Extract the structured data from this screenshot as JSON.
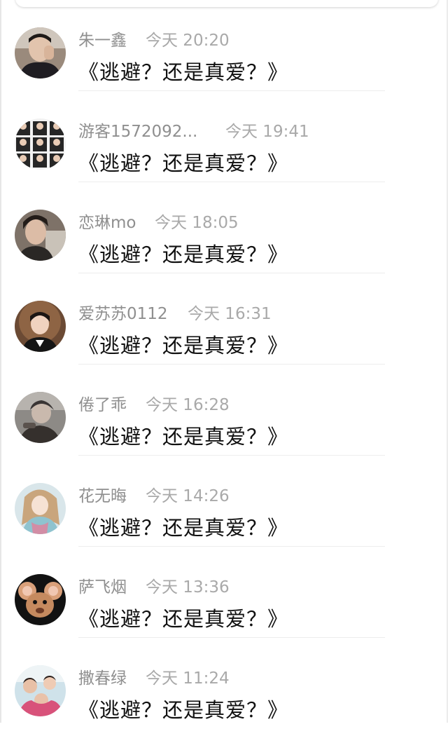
{
  "comments": [
    {
      "username": "朱一鑫",
      "time": "今天 20:20",
      "text": "《逃避？还是真爱？》",
      "avatar": "man-with-hand-on-face-avatar"
    },
    {
      "username": "游客1572092...",
      "time": "今天 19:41",
      "text": "《逃避？还是真爱？》",
      "avatar": "group-photo-grid-avatar"
    },
    {
      "username": "恋琳mo",
      "time": "今天 18:05",
      "text": "《逃避？还是真爱？》",
      "avatar": "young-man-selfie-avatar"
    },
    {
      "username": "爱苏苏0112",
      "time": "今天 16:31",
      "text": "《逃避？还是真爱？》",
      "avatar": "boy-portrait-avatar"
    },
    {
      "username": "倦了乖",
      "time": "今天 16:28",
      "text": "《逃避？还是真爱？》",
      "avatar": "anime-figure-avatar"
    },
    {
      "username": "花无晦",
      "time": "今天 14:26",
      "text": "《逃避？还是真爱？》",
      "avatar": "fantasy-girl-avatar"
    },
    {
      "username": "萨飞烟",
      "time": "今天 13:36",
      "text": "《逃避？还是真爱？》",
      "avatar": "cartoon-mouse-avatar"
    },
    {
      "username": "撒春绿",
      "time": "今天 11:24",
      "text": "《逃避？还是真爱？》",
      "avatar": "family-photo-avatar"
    }
  ]
}
